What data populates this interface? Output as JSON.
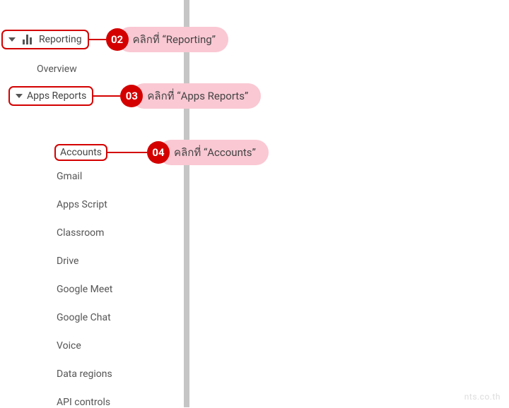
{
  "sidebar": {
    "reporting_label": "Reporting",
    "overview_label": "Overview",
    "apps_reports_label": "Apps Reports",
    "accounts_label": "Accounts",
    "items": [
      "Gmail",
      "Apps Script",
      "Classroom",
      "Drive",
      "Google Meet",
      "Google Chat",
      "Voice",
      "Data regions",
      "API controls"
    ]
  },
  "steps": {
    "s2": {
      "num": "02",
      "text": "คลิกที่ “Reporting”"
    },
    "s3": {
      "num": "03",
      "text": "คลิกที่ “Apps Reports”"
    },
    "s4": {
      "num": "04",
      "text": "คลิกที่ “Accounts”"
    }
  },
  "watermark": "nts.co.th"
}
